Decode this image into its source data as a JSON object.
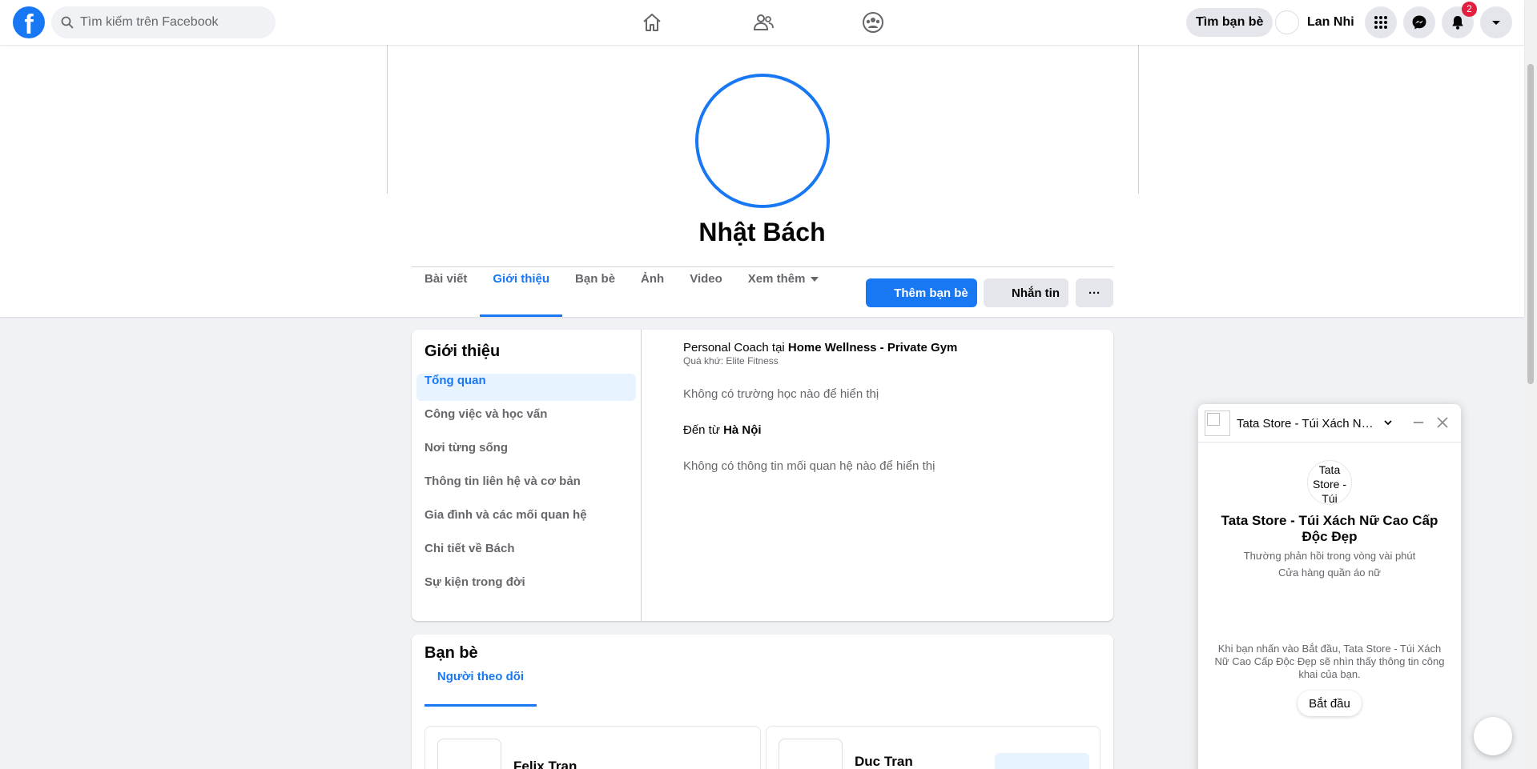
{
  "topbar": {
    "logo_letter": "f",
    "search_placeholder": "Tìm kiếm trên Facebook",
    "nav_icons": [
      "home-icon",
      "friends-icon",
      "groups-icon"
    ],
    "find_friends_label": "Tìm bạn bè",
    "user_name": "Lan Nhi",
    "notification_count": "2",
    "accent_color": "#1877f2"
  },
  "profile": {
    "name": "Nhật Bách",
    "tabs": [
      {
        "label": "Bài viết",
        "active": false
      },
      {
        "label": "Giới thiệu",
        "active": true
      },
      {
        "label": "Bạn bè",
        "active": false
      },
      {
        "label": "Ảnh",
        "active": false
      },
      {
        "label": "Video",
        "active": false
      },
      {
        "label": "Xem thêm",
        "active": false
      }
    ],
    "add_friend_label": "Thêm bạn bè",
    "message_label": "Nhắn tin",
    "more_label": "···"
  },
  "intro": {
    "title": "Giới thiệu",
    "menu": [
      {
        "label": "Tổng quan",
        "active": true
      },
      {
        "label": "Công việc và học vấn",
        "active": false
      },
      {
        "label": "Nơi từng sống",
        "active": false
      },
      {
        "label": "Thông tin liên hệ và cơ bản",
        "active": false
      },
      {
        "label": "Gia đình và các mối quan hệ",
        "active": false
      },
      {
        "label": "Chi tiết về Bách",
        "active": false
      },
      {
        "label": "Sự kiện trong đời",
        "active": false
      }
    ],
    "work_prefix": "Personal Coach tại ",
    "work_place": "Home Wellness - Private Gym",
    "work_past": "Quá khứ: Elite Fitness",
    "no_school": "Không có trường học nào để hiển thị",
    "from_prefix": "Đến từ ",
    "from_place": "Hà Nội",
    "no_relationship": "Không có thông tin mối quan hệ nào để hiển thị"
  },
  "friends": {
    "title": "Bạn bè",
    "tab_label": "Người theo dõi",
    "items": [
      {
        "name": "Felix Tran"
      },
      {
        "name": "Duc Tran"
      }
    ]
  },
  "chat": {
    "header_title": "Tata Store - Túi Xách Nữ…",
    "avatar_alt": "Tata Store - Túi Xách",
    "page_name": "Tata Store - Túi Xách Nữ Cao Cấp Độc Đẹp",
    "response_time": "Thường phản hồi trong vòng vài phút",
    "category": "Cửa hàng quần áo nữ",
    "consent_text": "Khi bạn nhấn vào Bắt đầu, Tata Store - Túi Xách Nữ Cao Cấp Độc Đẹp sẽ nhìn thấy thông tin công khai của bạn.",
    "start_label": "Bắt đầu"
  }
}
